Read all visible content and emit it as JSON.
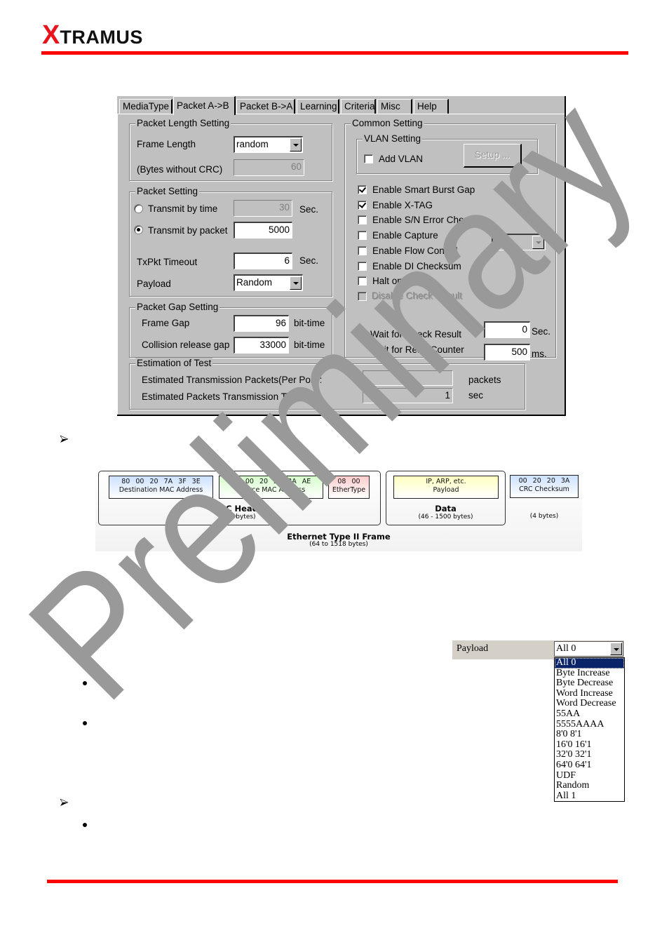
{
  "brand": {
    "logo_x": "X",
    "logo_rest": "TRAMUS",
    "accent_color": "#ff0000"
  },
  "dialog": {
    "tabs": [
      {
        "label": "MediaType",
        "active": false
      },
      {
        "label": "Packet A->B",
        "active": true
      },
      {
        "label": "Packet B->A",
        "active": false
      },
      {
        "label": "Learning",
        "active": false
      },
      {
        "label": "Criteria",
        "active": false
      },
      {
        "label": "Misc",
        "active": false
      },
      {
        "label": "Help",
        "active": false
      }
    ],
    "packet_length": {
      "title": "Packet Length Setting",
      "frame_length_label": "Frame Length",
      "frame_length_value": "random",
      "bytes_label": "(Bytes without CRC)",
      "bytes_value": "60"
    },
    "packet_setting": {
      "title": "Packet Setting",
      "by_time_label": "Transmit by time",
      "by_time_value": "30",
      "by_time_unit": "Sec.",
      "by_packet_label": "Transmit by packet",
      "by_packet_value": "5000",
      "selected_mode": "packet",
      "timeout_label": "TxPkt Timeout",
      "timeout_value": "6",
      "timeout_unit": "Sec.",
      "payload_label": "Payload",
      "payload_value": "Random"
    },
    "packet_gap": {
      "title": "Packet Gap Setting",
      "frame_gap_label": "Frame Gap",
      "frame_gap_value": "96",
      "frame_gap_unit": "bit-time",
      "collision_label": "Collision release gap",
      "collision_value": "33000",
      "collision_unit": "bit-time"
    },
    "common": {
      "title": "Common Setting",
      "vlan_title": "VLAN Setting",
      "add_vlan_label": "Add VLAN",
      "add_vlan_checked": false,
      "setup_button": "Setup ...",
      "options": [
        {
          "label": "Enable Smart Burst Gap",
          "checked": true,
          "disabled": false
        },
        {
          "label": "Enable X-TAG",
          "checked": true,
          "disabled": false
        },
        {
          "label": "Enable S/N Error Check",
          "checked": false,
          "disabled": false
        },
        {
          "label": "Enable Capture",
          "checked": false,
          "disabled": false
        },
        {
          "label": "Enable Flow Control",
          "checked": false,
          "disabled": false
        },
        {
          "label": "Enable DI Checksum",
          "checked": false,
          "disabled": false
        },
        {
          "label": "Halt on if Fail",
          "checked": false,
          "disabled": false
        },
        {
          "label": "Disable Check Result",
          "checked": false,
          "disabled": true
        }
      ],
      "capture_select": "All",
      "wait_check_label": "Wait for Check Result",
      "wait_check_value": "0",
      "wait_check_unit": "Sec.",
      "wait_read_label": "Wait for Read Counter",
      "wait_read_value": "500",
      "wait_read_unit": "ms."
    },
    "estimation": {
      "title": "Estimation of Test",
      "packets_label": "Estimated Transmission Packets(Per Port):",
      "packets_value": "",
      "packets_unit": "packets",
      "time_label": "Estimated Packets Transmission Time:",
      "time_value": "1",
      "time_unit": "sec"
    }
  },
  "ethernet_frame": {
    "dest_hex": "80 00 20 7A 3F 3E",
    "dest_label": "Destination MAC Address",
    "src_hex": "80 00 20 20 3A AE",
    "src_label": "Source MAC Address",
    "type_hex": "08 00",
    "type_label": "EtherType",
    "mac_header_title": "MAC Header",
    "mac_header_size": "(14 bytes)",
    "payload_top": "IP, ARP, etc.",
    "payload_label": "Payload",
    "data_title": "Data",
    "data_size": "(46 - 1500 bytes)",
    "crc_hex": "00 20 20 3A",
    "crc_label": "CRC Checksum",
    "crc_size": "(4 bytes)",
    "frame_title": "Ethernet Type II Frame",
    "frame_size": "(64 to 1518 bytes)",
    "colors": {
      "dest": "#cce0ff",
      "src": "#d6ffcc",
      "type": "#ffcccc",
      "payload": "#ffffc0",
      "crc": "#cce0ff"
    }
  },
  "payload_dropdown": {
    "label": "Payload",
    "selected": "All 0",
    "options": [
      "All 0",
      "Byte Increase",
      "Byte Decrease",
      "Word Increase",
      "Word Decrease",
      "55AA",
      "5555AAAA",
      "8'0 8'1",
      "16'0 16'1",
      "32'0 32'1",
      "64'0 64'1",
      "UDF",
      "Random",
      "All 1"
    ]
  },
  "watermark": {
    "text": "Preliminary",
    "color": "#999999"
  }
}
